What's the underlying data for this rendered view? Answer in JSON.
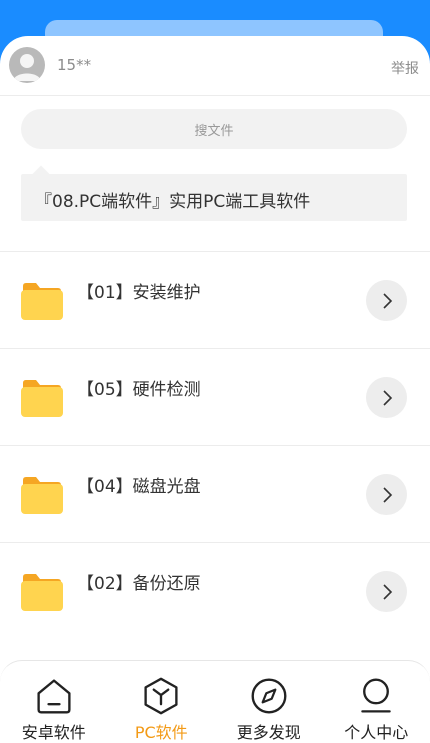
{
  "user": {
    "name": "15**",
    "report_label": "举报"
  },
  "search": {
    "placeholder": "搜文件"
  },
  "description": "『08.PC端软件』实用PC端工具软件",
  "folders": [
    {
      "label": "【01】安装维护"
    },
    {
      "label": "【05】硬件检测"
    },
    {
      "label": "【04】磁盘光盘"
    },
    {
      "label": "【02】备份还原"
    }
  ],
  "tabs": [
    {
      "label": "安卓软件",
      "icon": "home-icon"
    },
    {
      "label": "PC软件",
      "icon": "pc-software-icon",
      "active": true
    },
    {
      "label": "更多发现",
      "icon": "compass-icon"
    },
    {
      "label": "个人中心",
      "icon": "person-icon"
    }
  ],
  "colors": {
    "header_blue": "#1a8cff",
    "active_orange": "#f39a16",
    "folder_yellow": "#ffd44f",
    "folder_tab": "#f5a623"
  }
}
